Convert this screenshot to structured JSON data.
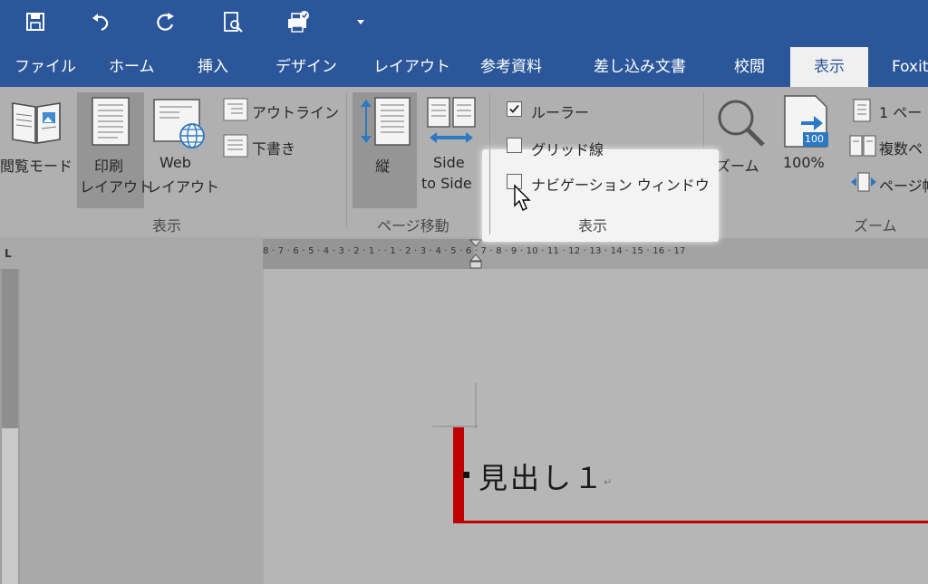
{
  "quick_access": {
    "icons": [
      "save-icon",
      "undo-icon",
      "redo-icon",
      "print-preview-icon",
      "quick-print-icon",
      "customize-dropdown-icon"
    ]
  },
  "tabs": [
    {
      "label": "ファイル"
    },
    {
      "label": "ホーム"
    },
    {
      "label": "挿入"
    },
    {
      "label": "デザイン"
    },
    {
      "label": "レイアウト"
    },
    {
      "label": "参考資料"
    },
    {
      "label": "差し込み文書"
    },
    {
      "label": "校閲"
    },
    {
      "label": "表示",
      "active": true
    },
    {
      "label": "Foxit"
    }
  ],
  "ribbon": {
    "views": {
      "read_mode": "閲覧モード",
      "print_layout_1": "印刷",
      "print_layout_2": "レイアウト",
      "web_layout_1": "Web",
      "web_layout_2": "レイアウト",
      "outline": "アウトライン",
      "draft": "下書き",
      "group_label": "表示"
    },
    "page_movement": {
      "vertical": "縦",
      "side_to_side_1": "Side",
      "side_to_side_2": "to Side",
      "group_label": "ページ移動"
    },
    "show": {
      "ruler": {
        "label": "ルーラー",
        "checked": true
      },
      "gridlines": {
        "label": "グリッド線",
        "checked": false
      },
      "navigation_pane": {
        "label": "ナビゲーション ウィンドウ",
        "checked": false
      },
      "group_label": "表示"
    },
    "zoom": {
      "zoom_label": "ズーム",
      "percent_label": "100%",
      "percent_badge": "100",
      "one_page": "1 ペー",
      "multiple_pages": "複数ペ",
      "page_width": "ページ幅",
      "group_label": "ズーム"
    }
  },
  "ruler": {
    "ticks": "8 · 7 · 6 · 5 · 4 · 3 · 2 · 1 ·  · 1 · 2 · 3 · 4 · 5 · 6 · 7 · 8 · 9 · 10 · 11 · 12 · 13 · 14 · 15 · 16 · 17",
    "corner_symbol": "L"
  },
  "document": {
    "heading_text": "見出し１",
    "paragraph_mark": "↵"
  },
  "colors": {
    "title_bar": "#2b579a",
    "heading_bar": "#c00000"
  }
}
